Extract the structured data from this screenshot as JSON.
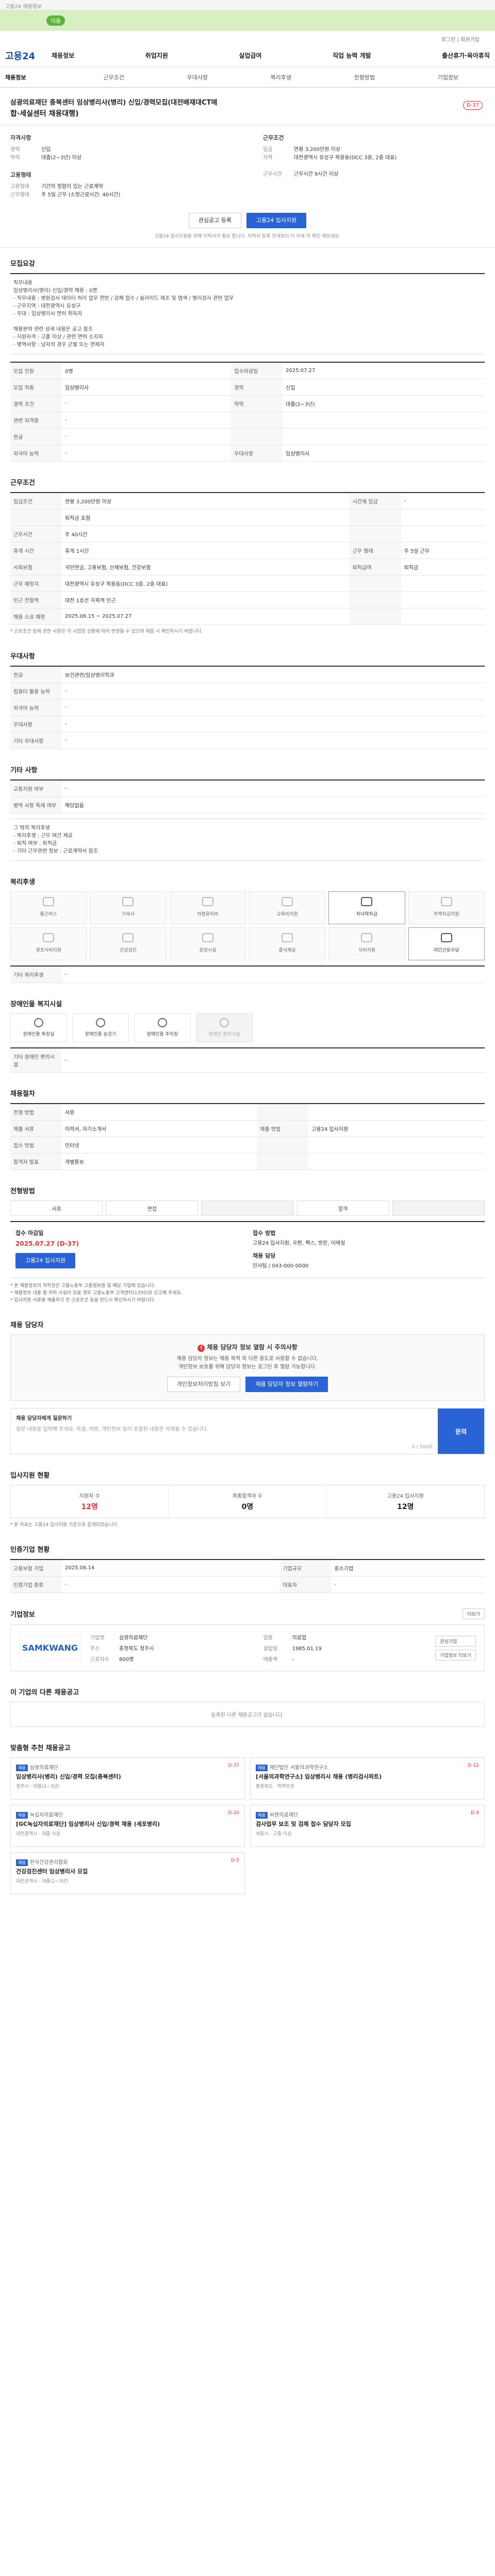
{
  "top": {
    "notice": "고용24 채용정보",
    "pill": "이동",
    "util": "로그인 | 회원가입"
  },
  "gnb": {
    "logo": "고용24",
    "menu": [
      "채용정보",
      "취업지원",
      "실업급여",
      "직업 능력 개발",
      "출산휴가·육아휴직"
    ]
  },
  "tabs": [
    "채용정보",
    "근무조건",
    "우대사항",
    "복리후생",
    "전형방법",
    "기업정보"
  ],
  "header": {
    "company": "삼광의료재단 충북센터 임상병리사(병리) 신입/경력모집(대전배재대CT매",
    "title": "합·세실센터 채용대행)",
    "dday": "D-37"
  },
  "summary": {
    "left": [
      {
        "title": "자격사항",
        "rows": [
          [
            "경력",
            "신입"
          ],
          [
            "학력",
            "대졸(2~3년) 이상"
          ]
        ]
      },
      {
        "title": "고용형태",
        "rows": [
          [
            "고용형태",
            "기간의 정함이 있는 근로계약"
          ],
          [
            "근무형태",
            "주 5일 근무 (소정근로시간: 40시간)"
          ]
        ]
      }
    ],
    "right": [
      {
        "title": "근무조건",
        "rows": [
          [
            "임금",
            "연봉 3,200만원 이상"
          ],
          [
            "지역",
            "대전광역시 유성구 복용동(DCC 3층, 2층 대표)"
          ]
        ]
      },
      {
        "title": "",
        "rows": [
          [
            "근무시간",
            "근무시간 9시간 이상"
          ]
        ]
      }
    ]
  },
  "buttons": {
    "scrap": "관심공고 등록",
    "apply": "고용24 입사지원",
    "note": "고용24 입사지원을 위해 이력서가 필요 합니다. 이력서 등록 안내보다 더 자세 히 확인 해보세요."
  },
  "sections": {
    "recruit": "모집요강",
    "conditions": "근무조건",
    "preference": "우대사항",
    "welfare": "복리후생",
    "disability": "장애인을 복지시설",
    "method": "채용절차",
    "apply": "전형방법",
    "contact": "채용 담당자",
    "stats": "입사지원 현황",
    "manager": "인증기업 현황",
    "company": "기업정보",
    "other": "이 기업의 다른 채용공고",
    "recommend": "맞춤형 추천 채용공고"
  },
  "recruit": {
    "desc": "직무내용\n임상병리사(병리) 신입/경력 채용 : 0명\n - 직무내용 : 병원검사 데이터 처리 업무 전반 / 검체 접수 / 슬라이드 제조 및 염색 / 병리검사 관련 업무\n - 근무지역 : 대전광역시 유성구\n - 우대 : 임상병리사 면허 취득자\n\n채용분야 관련 상세 내용은 공고 참조\n - 지원자격 : 고졸 이상 / 관련 면허 소지자\n - 병역사항 : 남자의 경우 군필 또는 면제자",
    "rows": [
      [
        [
          "모집 인원",
          "0명"
        ],
        [
          "접수마감일",
          "2025.07.27"
        ]
      ],
      [
        [
          "모집 직종",
          "임상병리사"
        ],
        [
          "경력",
          "신입"
        ]
      ],
      [
        [
          "경력 조건",
          "-"
        ],
        [
          "학력",
          "대졸(2~3년)"
        ]
      ],
      [
        [
          "관련 자격증",
          "-"
        ],
        [
          "",
          ""
        ]
      ],
      [
        [
          "전공",
          "-"
        ],
        [
          "",
          ""
        ]
      ],
      [
        [
          "외국어 능력",
          "-"
        ],
        [
          "우대사항",
          "임상병리사"
        ]
      ]
    ]
  },
  "conditions": {
    "rows": [
      [
        [
          "임금조건",
          "연봉 3,200만원 이상"
        ],
        [
          "시간제 임금",
          "-"
        ]
      ],
      [
        [
          "",
          "퇴직금 포함"
        ],
        [
          "",
          ""
        ]
      ],
      [
        [
          "근무시간",
          "주 40시간"
        ],
        [
          "",
          ""
        ]
      ],
      [
        [
          "휴게 시간",
          "휴게 1시간"
        ],
        [
          "근무 형태",
          "주 5일 근무"
        ]
      ],
      [
        [
          "사회보험",
          "국민연금, 고용보험, 산재보험, 건강보험"
        ],
        [
          "퇴직급여",
          "퇴직금"
        ]
      ],
      [
        [
          "근무 예정지",
          "대전광역시 유성구 복용동(DCC 3층, 2층 대표)"
        ],
        [
          "",
          ""
        ]
      ],
      [
        [
          "인근 전철역",
          "대전 1호선 지족역 인근"
        ],
        [
          "",
          ""
        ]
      ],
      [
        [
          "채용 소요 예정",
          "2025.06.15 ~ 2025.07.27"
        ],
        [
          "",
          ""
        ]
      ]
    ],
    "footnote": "* 근로조건 등에 관한 사항은 각 사업장 상황에 따라 변경될 수 있으며 채용 시 확인하시기 바랍니다."
  },
  "preference": {
    "rows": [
      [
        [
          "전공",
          "보건관련/임상병리학과"
        ]
      ],
      [
        [
          "컴퓨터 활용 능력",
          "-"
        ]
      ],
      [
        [
          "외국어 능력",
          "-"
        ]
      ],
      [
        [
          "우대사항",
          "-"
        ]
      ],
      [
        [
          "기타 우대사항",
          "-"
        ]
      ]
    ]
  },
  "edu": {
    "title": "기타 사항",
    "rows": [
      [
        [
          "교통지원 여부",
          "-"
        ]
      ],
      [
        [
          "병역 사항 특례 여부",
          "해당없음"
        ]
      ]
    ],
    "body": "그 밖의 복리후생\n - 복리후생 : 근무 여건 제공\n - 퇴직 여부 : 퇴직금\n - 기타 근무관련 정보 : 근로계약서 참조"
  },
  "welfare": {
    "items": [
      "통근버스",
      "기숙사",
      "차량유지비",
      "교육비지원",
      "자녀학자금",
      "주택자금지원",
      "경조사비지원",
      "건강검진",
      "휴양시설",
      "중식제공",
      "식비지원",
      "야간근로수당"
    ],
    "on": [
      4,
      11
    ],
    "other": "기타 복리후생"
  },
  "disability": {
    "items": [
      "장애인용 화장실",
      "장애인용 승강기",
      "장애인용 주차장",
      "장애인 편의시설"
    ],
    "other": "기타 장애인 편의시설"
  },
  "method": {
    "rows": [
      [
        [
          "전형 방법",
          "서류"
        ],
        [
          "",
          ""
        ]
      ],
      [
        [
          "제출 서류",
          "이력서, 자기소개서"
        ],
        [
          "제출 방법",
          "고용24 입사지원"
        ]
      ],
      [
        [
          "접수 방법",
          "인터넷"
        ],
        [
          "",
          ""
        ]
      ],
      [
        [
          "합격자 발표",
          "개별통보"
        ],
        [
          "",
          ""
        ]
      ]
    ]
  },
  "steps": [
    "서류",
    "면접",
    "",
    "합격",
    ""
  ],
  "apply": {
    "period_label": "접수 마감일",
    "period": "2025.07.27 (D-37)",
    "method_label": "접수 방법",
    "method": "고용24 입사지원, 우편, 팩스, 방문, 이메일",
    "contact_label": "채용 담당",
    "contact": "인사팀 / 043-000-0000",
    "btn": "고용24 입사지원",
    "bullets": [
      "* 본 채용정보의 저작권은 고용노동부 고용정보원 및 해당 기업에 있습니다.",
      "* 채용정보 내용 중 허위 사실이 있을 경우 고용노동부 고객센터(1350)로 신고해 주세요.",
      "* 입사지원 서류를 제출하기 전 근로조건 등을 반드시 확인하시기 바랍니다."
    ]
  },
  "contact_box": {
    "head": "채용 담당자 정보 열람 시 주의사항",
    "body": "채용 담당자 정보는 채용 목적 외 다른 용도로 사용할 수 없습니다.\n개인정보 보호를 위해 담당자 정보는 로그인 후 열람 가능합니다.",
    "btn1": "개인정보처리방침 보기",
    "btn2": "채용 담당자 정보 열람하기"
  },
  "qa": {
    "label": "채용 담당자에게 질문하기",
    "placeholder": "질문 내용을 입력해 주세요. 욕설, 비방, 개인정보 등이 포함된 내용은 삭제될 수 있습니다.",
    "count": "0 / 500자",
    "send": "문의"
  },
  "stats": {
    "items": [
      [
        "지원자 수",
        "12명"
      ],
      [
        "최종합격자 수",
        "0명"
      ],
      [
        "고용24 입사지원",
        "12명"
      ]
    ],
    "note": "* 본 자료는 고용24 입사지원 기준으로 집계되었습니다."
  },
  "manager": {
    "rows": [
      [
        [
          "고용보험 가입",
          "2025.06.14"
        ],
        [
          "기업규모",
          "중소기업"
        ]
      ],
      [
        [
          "인증기업 종류",
          "-"
        ],
        [
          "대표자",
          "-"
        ]
      ]
    ]
  },
  "company": {
    "logo": "SAMKWANG",
    "rows": [
      [
        "기업명",
        "삼광의료재단"
      ],
      [
        "업종",
        "의료업"
      ],
      [
        "주소",
        "충청북도 청주시"
      ],
      [
        "설립일",
        "1985.01.19"
      ],
      [
        "근로자수",
        "800명"
      ],
      [
        "매출액",
        "-"
      ]
    ],
    "btn1": "관심기업",
    "btn2": "기업정보 더보기",
    "mapview": "더보기"
  },
  "other": {
    "empty": "등록된 다른 채용공고가 없습니다."
  },
  "recommend": {
    "items": [
      {
        "company": "삼광의료재단",
        "title": "임상병리사(병리) 신입/경력 모집(충북센터)",
        "meta": "청주시 · 대졸(2~3년)",
        "dday": "D-37"
      },
      {
        "company": "재단법인 서울의과학연구소",
        "title": "[서울의과학연구소] 임상병리사 채용 (병리검사파트)",
        "meta": "충청북도 · 학력무관",
        "dday": "D-12"
      },
      {
        "company": "녹십자의료재단",
        "title": "[GC녹십자의료재단] 임상병리사 신입/경력 채용 (세포병리)",
        "meta": "대전광역시 · 대졸 이상",
        "dday": "D-20"
      },
      {
        "company": "씨젠의료재단",
        "title": "검사업무 보조 및 검체 접수 담당자 모집",
        "meta": "세종시 · 고졸 이상",
        "dday": "D-9"
      },
      {
        "company": "한국건강관리협회",
        "title": "건강검진센터 임상병리사 모집",
        "meta": "대전광역시 · 대졸(2~3년)",
        "dday": "D-5"
      }
    ]
  }
}
